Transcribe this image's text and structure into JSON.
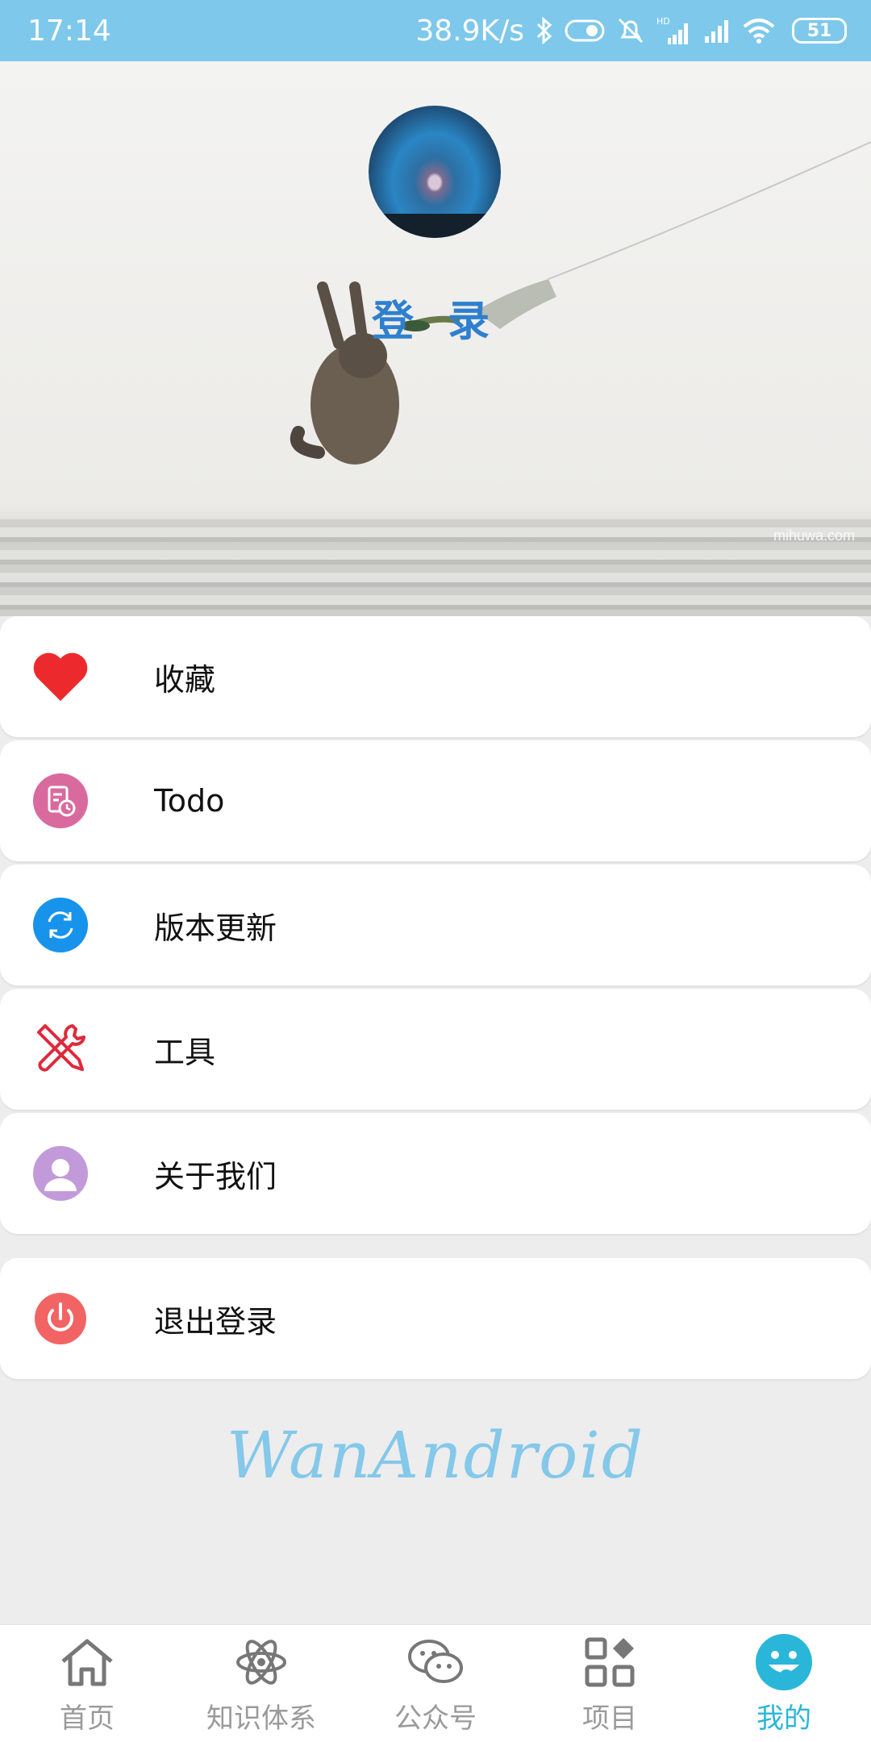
{
  "status_bar": {
    "time": "17:14",
    "network_speed": "38.9K/s",
    "signal_label": "HD",
    "battery": "51"
  },
  "header": {
    "login_label": "登 录",
    "watermark": "mihuwa.com"
  },
  "menu": {
    "items": [
      {
        "label": "收藏",
        "icon": "heart-icon"
      },
      {
        "label": "Todo",
        "icon": "todo-icon"
      },
      {
        "label": "版本更新",
        "icon": "refresh-icon"
      },
      {
        "label": "工具",
        "icon": "tools-icon"
      },
      {
        "label": "关于我们",
        "icon": "user-icon"
      }
    ],
    "logout": {
      "label": "退出登录",
      "icon": "power-icon"
    }
  },
  "brand": "WanAndroid",
  "tabs": [
    {
      "label": "首页",
      "icon": "home-icon"
    },
    {
      "label": "知识体系",
      "icon": "atom-icon"
    },
    {
      "label": "公众号",
      "icon": "wechat-icon"
    },
    {
      "label": "项目",
      "icon": "grid-icon"
    },
    {
      "label": "我的",
      "icon": "smiley-icon"
    }
  ],
  "colors": {
    "status_bar": "#7ec8ec",
    "accent": "#2ab6d8",
    "login": "#2f7fcf",
    "heart": "#ec2a2e",
    "todo": "#d96a9e",
    "refresh": "#1893ec",
    "tools": "#de2a3c",
    "user": "#c39ad9",
    "power": "#f26464",
    "brand": "#84c8ea"
  }
}
